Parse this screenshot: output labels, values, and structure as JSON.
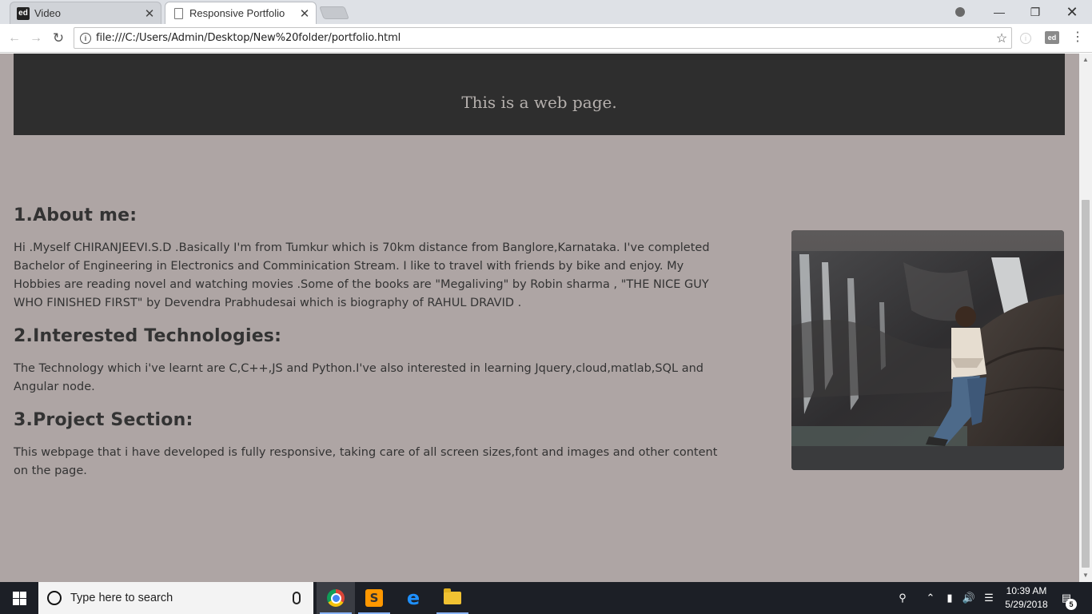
{
  "browser": {
    "tabs": [
      {
        "title": "Video",
        "favicon": "ed"
      },
      {
        "title": "Responsive Portfolio"
      }
    ],
    "url": "file:///C:/Users/Admin/Desktop/New%20folder/portfolio.html",
    "ext_label": "ed"
  },
  "page": {
    "banner_text": "This is a web page.",
    "sections": [
      {
        "heading": "1.About me:",
        "text": "Hi .Myself CHIRANJEEVI.S.D .Basically I'm from Tumkur which is 70km distance from Banglore,Karnataka. I've completed Bachelor of Engineering in Electronics and Comminication Stream. I like to travel with friends by bike and enjoy. My Hobbies are reading novel and watching movies .Some of the books are \"Megaliving\" by Robin sharma , \"THE NICE GUY WHO FINISHED FIRST\" by Devendra Prabhudesai which is biography of RAHUL DRAVID ."
      },
      {
        "heading": "2.Interested Technologies:",
        "text": "The Technology which i've learnt are C,C++,JS and Python.I've also interested in learning Jquery,cloud,matlab,SQL and Angular node."
      },
      {
        "heading": "3.Project Section:",
        "text": "This webpage that i have developed is fully responsive, taking care of all screen sizes,font and images and other content on the page."
      }
    ],
    "colors": {
      "page_bg": "#aea5a4",
      "banner_bg": "#2e2e2e",
      "banner_text": "#b5b0ad"
    }
  },
  "taskbar": {
    "search_placeholder": "Type here to search",
    "apps": [
      "chrome",
      "sublime-text",
      "edge",
      "file-explorer"
    ],
    "time": "10:39 AM",
    "date": "5/29/2018",
    "notification_count": "5"
  }
}
